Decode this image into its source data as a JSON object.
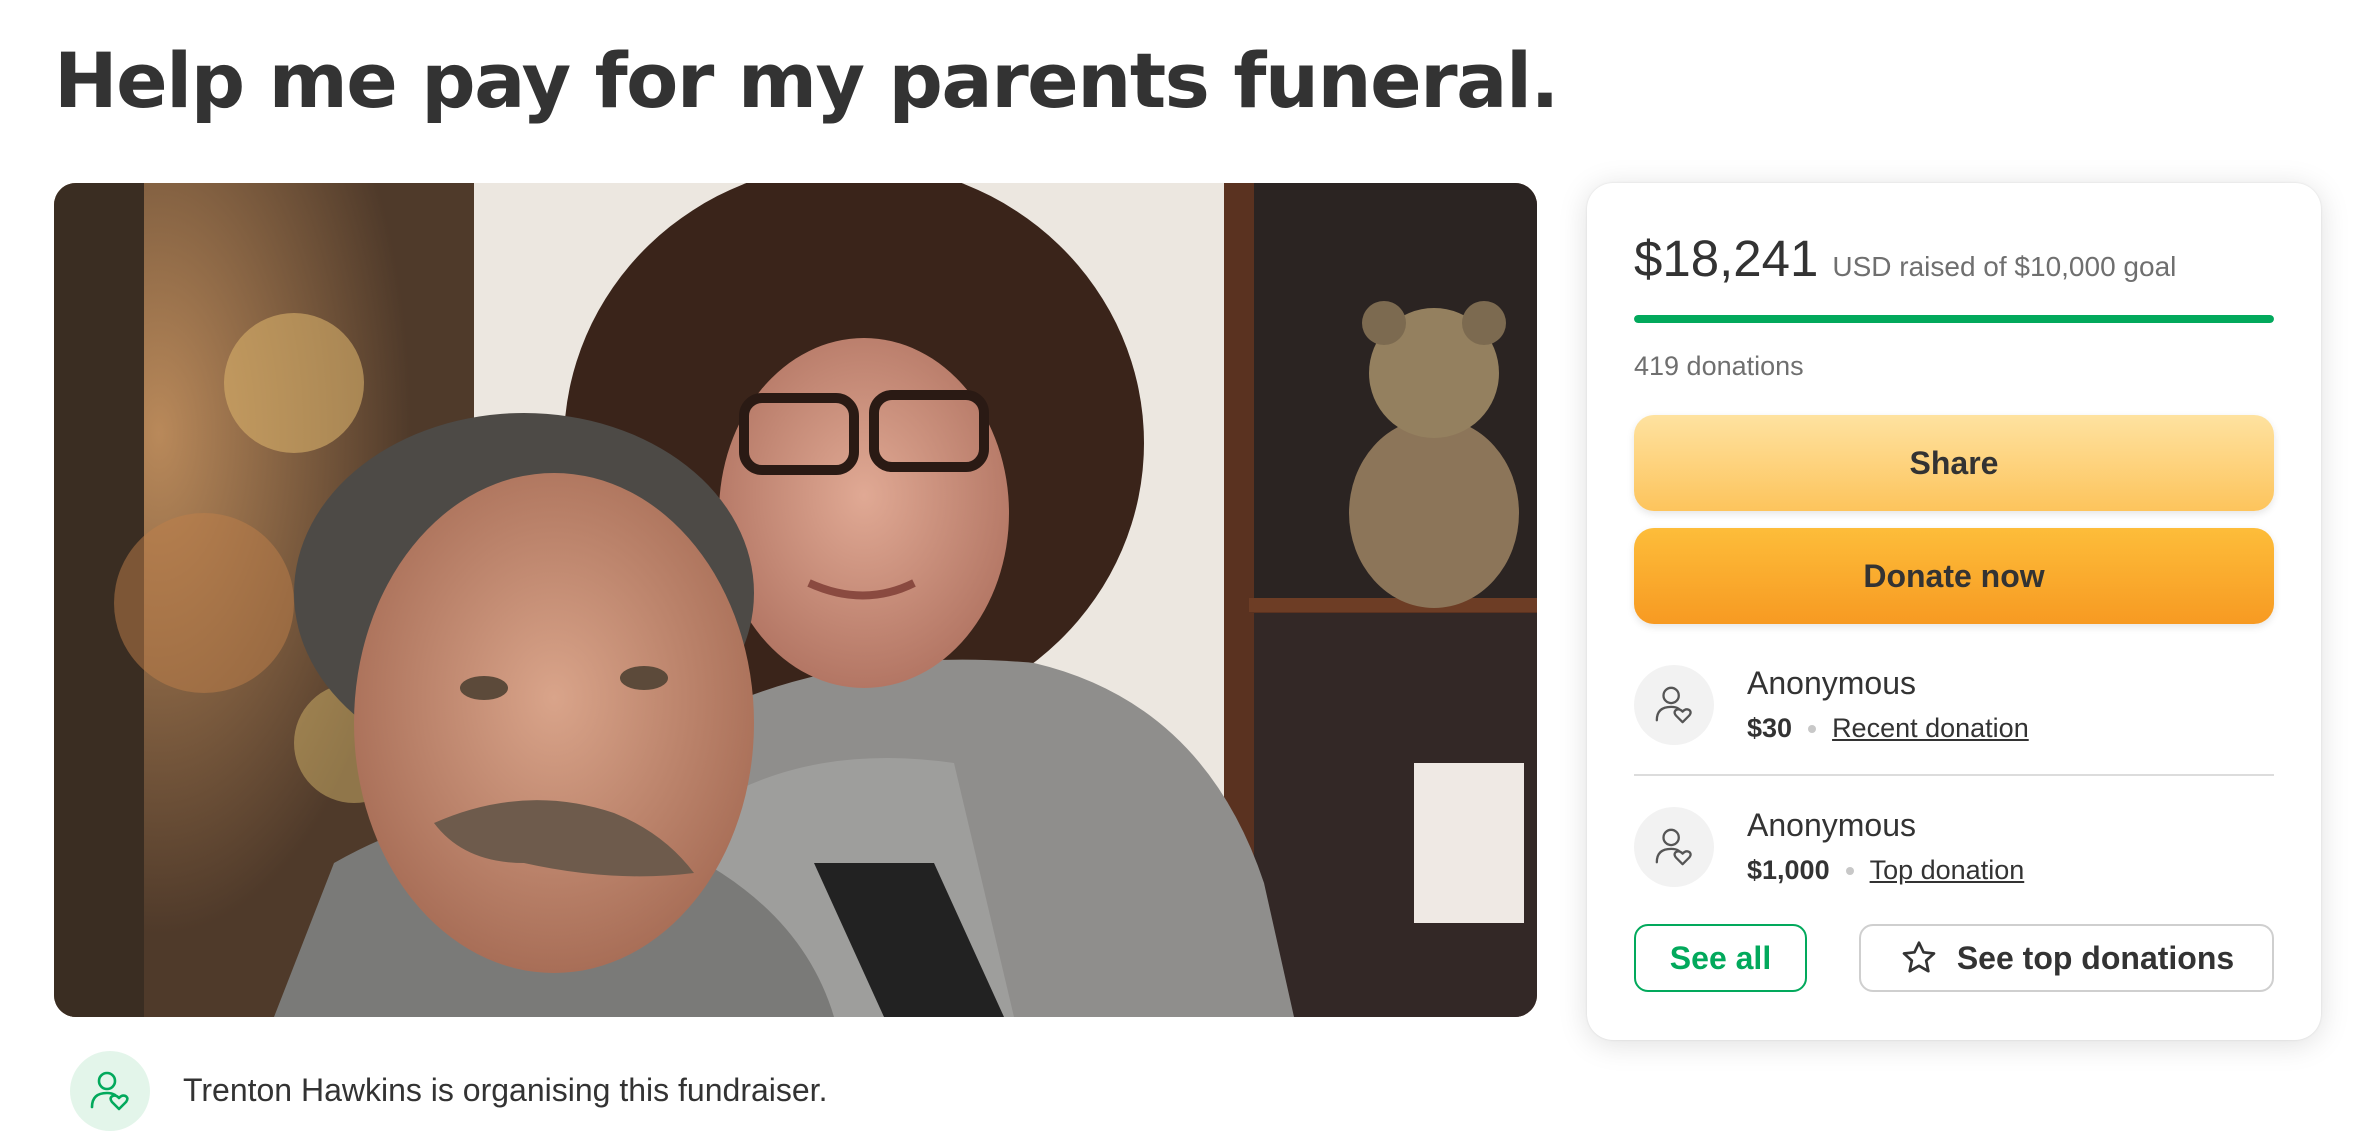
{
  "page": {
    "title": "Help me pay for my parents funeral."
  },
  "organizer": {
    "text": "Trenton Hawkins is organising this fundraiser.",
    "icon": "user-heart-icon"
  },
  "card": {
    "raised_amount": "$18,241",
    "raised_goal_text": "USD raised of $10,000 goal",
    "progress_fraction": 1.0,
    "donation_count": "419 donations",
    "share_label": "Share",
    "donate_label": "Donate now",
    "donors": [
      {
        "name": "Anonymous",
        "amount": "$30",
        "tag": "Recent donation",
        "icon": "user-heart-icon"
      },
      {
        "name": "Anonymous",
        "amount": "$1,000",
        "tag": "Top donation",
        "icon": "user-heart-icon"
      }
    ],
    "see_all_label": "See all",
    "see_top_label": "See top donations",
    "see_top_icon": "star-icon"
  },
  "colors": {
    "brand_green": "#02a95c",
    "share_button": "#fdc45c",
    "donate_button": "#f79a22",
    "text": "#333333",
    "muted_text": "#6f6f6f"
  }
}
